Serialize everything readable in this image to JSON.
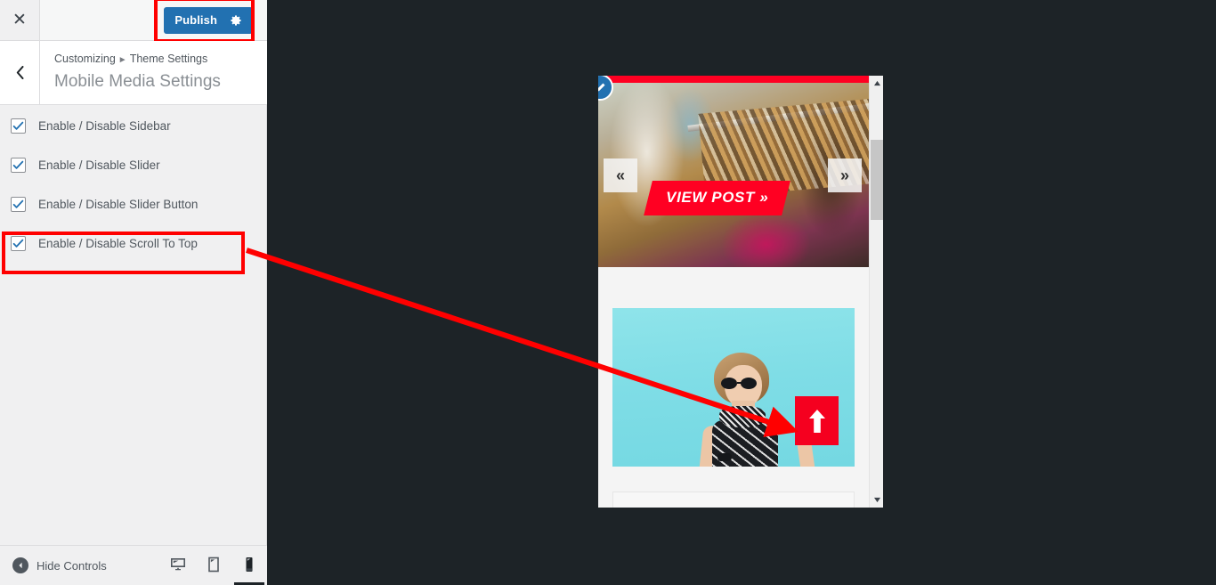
{
  "customizer": {
    "header": {
      "close_label": "✕",
      "close_icon": "close-icon",
      "publish_label": "Publish",
      "publish_gear_icon": "gear-icon",
      "publish_color": "#2271b1"
    },
    "titlebar": {
      "back_icon": "chevron-left-icon",
      "breadcrumb_root": "Customizing",
      "breadcrumb_separator": "►",
      "breadcrumb_parent": "Theme Settings",
      "panel_title": "Mobile Media Settings"
    },
    "controls": [
      {
        "label": "Enable / Disable Sidebar",
        "checked": true
      },
      {
        "label": "Enable / Disable Slider",
        "checked": true
      },
      {
        "label": "Enable / Disable Slider Button",
        "checked": true
      },
      {
        "label": "Enable / Disable Scroll To Top",
        "checked": true
      }
    ],
    "footer": {
      "hide_controls_label": "Hide Controls",
      "hide_controls_icon": "collapse-left-icon",
      "devices": [
        {
          "name": "desktop",
          "icon": "desktop-icon",
          "active": false
        },
        {
          "name": "tablet",
          "icon": "tablet-icon",
          "active": false
        },
        {
          "name": "mobile",
          "icon": "mobile-icon",
          "active": true
        }
      ]
    }
  },
  "preview": {
    "device": "mobile",
    "edit_shortcut_icon": "edit-pencil-icon",
    "slider": {
      "prev_label": "«",
      "next_label": "»",
      "button_label": "VIEW POST  »",
      "accent_color": "#ff0022"
    },
    "scroll_to_top": {
      "icon": "arrow-up-icon",
      "color": "#f5001f"
    },
    "scrollbar": {
      "up_icon": "triangle-up-icon",
      "down_icon": "triangle-down-icon"
    }
  },
  "annotations": {
    "highlight_color": "#ff0000",
    "publish_highlight": {
      "label": "Publish button highlight"
    },
    "scroll_top_highlight": {
      "label": "Enable / Disable Scroll To Top highlight"
    },
    "arrow": {
      "label": "points from Scroll To Top control to scroll-to-top button in preview"
    }
  }
}
